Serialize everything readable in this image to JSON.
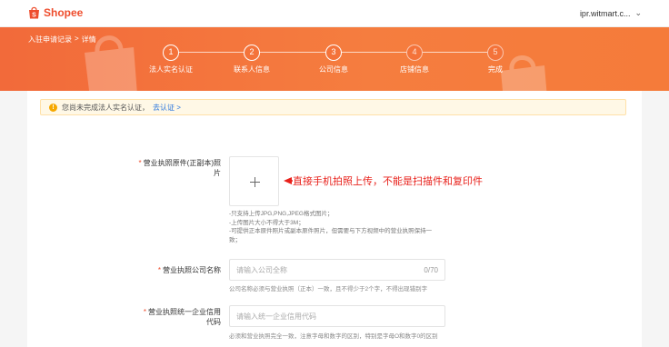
{
  "header": {
    "brand": "Shopee",
    "account": "ipr.witmart.c...",
    "colors": {
      "brand": "#ee4d2d",
      "banner": "#f5783c"
    }
  },
  "breadcrumb": {
    "root": "入驻申请记录",
    "separator": ">",
    "current": "详情"
  },
  "steps": [
    {
      "num": "1",
      "label": "法人实名认证"
    },
    {
      "num": "2",
      "label": "联系人信息"
    },
    {
      "num": "3",
      "label": "公司信息"
    },
    {
      "num": "4",
      "label": "店铺信息"
    },
    {
      "num": "5",
      "label": "完成"
    }
  ],
  "notice": {
    "text": "您尚未完成法人实名认证，",
    "link": "去认证",
    "link_arrow": ">"
  },
  "form": {
    "license_label_line1": "营业执照原件(正副本)照",
    "license_label_line2": "片",
    "annotation": "直接手机拍照上传，不能是扫描件和复印件",
    "hints": [
      "-只支持上传JPG,PNG,JPEG格式图片；",
      "-上传图片大小不得大于3M；",
      "-可提供正本原件照片或副本原件照片，但需要与下方视频中的营业执照保持一",
      "致；"
    ],
    "company_name_label": "营业执照公司名称",
    "company_name_placeholder": "请输入公司全称",
    "company_name_count": "0/70",
    "company_name_help": "公司名称必须与营业执照（正本）一致，且不得少于2个字，不得出现错别字",
    "credit_code_label_line1": "营业执照统一企业信用",
    "credit_code_label_line2": "代码",
    "credit_code_placeholder": "请输入统一企业信用代码",
    "credit_code_help": "必须和营业执照完全一致，注意字母和数字的区别，特别是字母O和数字0的区别",
    "required_mark": "*"
  }
}
